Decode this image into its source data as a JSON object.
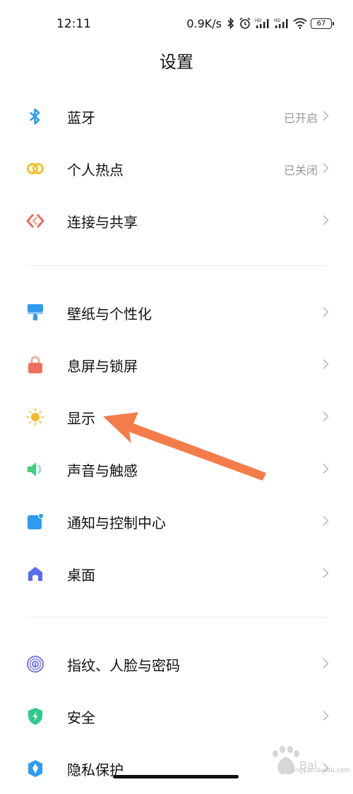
{
  "status_bar": {
    "time": "12:11",
    "net_speed": "0.9K/s",
    "battery": "67",
    "icons": [
      "bluetooth-icon",
      "alarm-icon",
      "hd-signal-icon",
      "hd-signal-icon",
      "wifi-icon",
      "battery-icon"
    ]
  },
  "header": {
    "title": "设置"
  },
  "groups": [
    {
      "items": [
        {
          "label": "蓝牙",
          "value": "已开启",
          "icon": "bluetooth-icon",
          "color": "#2d9bf0"
        },
        {
          "label": "个人热点",
          "value": "已关闭",
          "icon": "hotspot-icon",
          "color": "#f2c12e"
        },
        {
          "label": "连接与共享",
          "value": "",
          "icon": "connection-share-icon",
          "color": "#ee6b5a"
        }
      ]
    },
    {
      "items": [
        {
          "label": "壁纸与个性化",
          "value": "",
          "icon": "wallpaper-brush-icon",
          "color": "#2d9bf0"
        },
        {
          "label": "息屏与锁屏",
          "value": "",
          "icon": "lock-icon",
          "color": "#f06e5e"
        },
        {
          "label": "显示",
          "value": "",
          "icon": "sun-icon",
          "color": "#f5b72c"
        },
        {
          "label": "声音与触感",
          "value": "",
          "icon": "speaker-icon",
          "color": "#3fcf7f"
        },
        {
          "label": "通知与控制中心",
          "value": "",
          "icon": "notification-icon",
          "color": "#2d9bf0"
        },
        {
          "label": "桌面",
          "value": "",
          "icon": "home-icon",
          "color": "#5a6cf0"
        }
      ]
    },
    {
      "items": [
        {
          "label": "指纹、人脸与密码",
          "value": "",
          "icon": "fingerprint-icon",
          "color": "#7a78e6"
        },
        {
          "label": "安全",
          "value": "",
          "icon": "shield-icon",
          "color": "#2fc98a"
        },
        {
          "label": "隐私保护",
          "value": "",
          "icon": "privacy-icon",
          "color": "#2d9bf0"
        }
      ]
    }
  ],
  "annotation": {
    "arrow_color": "#f47c4a",
    "points_to": "显示"
  },
  "watermark": {
    "text": "jingyan.baidu.com"
  }
}
